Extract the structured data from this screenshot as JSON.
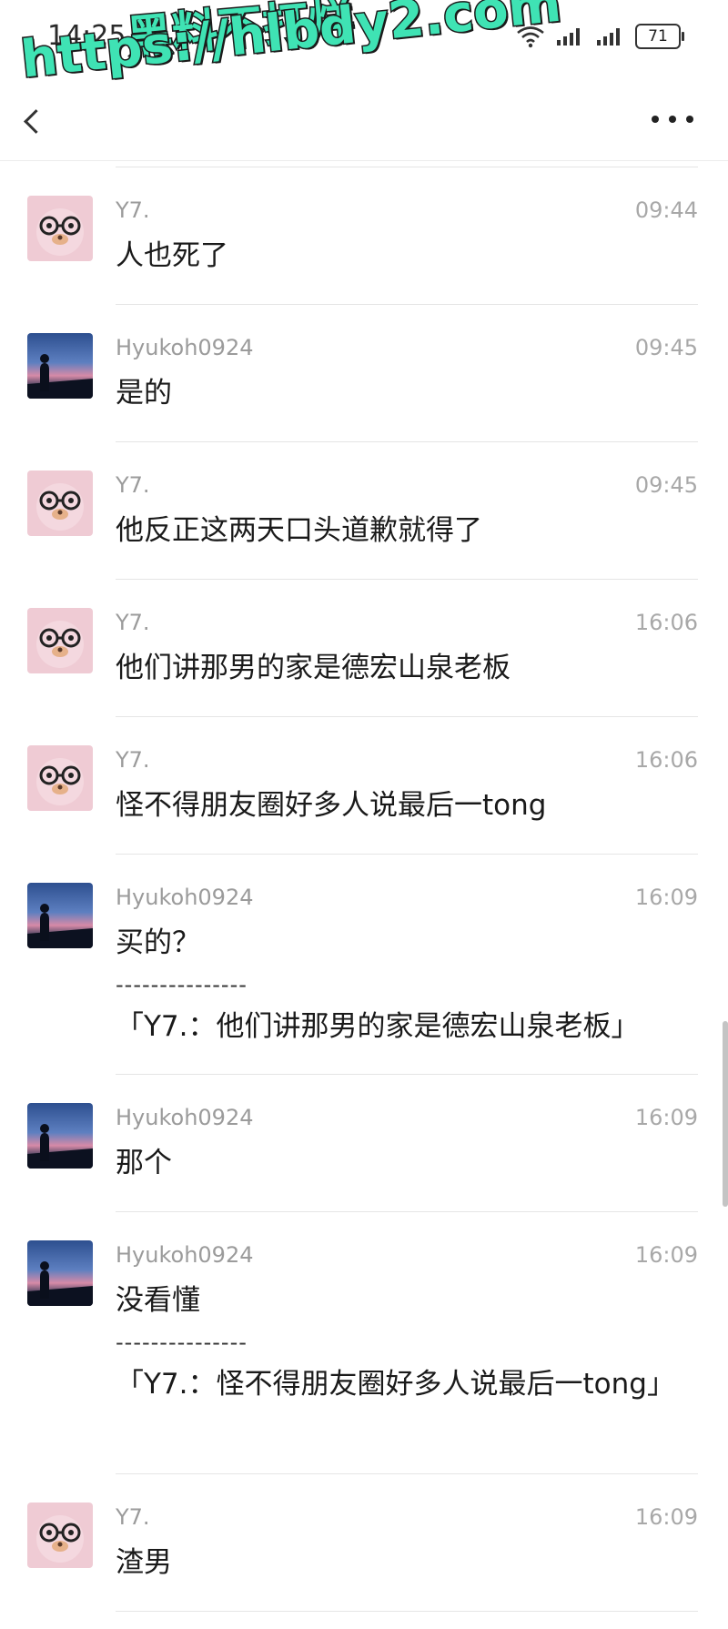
{
  "status": {
    "time": "14:25",
    "battery": "71"
  },
  "watermark": {
    "line1": "黑料不打烊",
    "line2": "https://hlbdy2.com"
  },
  "messages": [
    {
      "sender": "Y7.",
      "time": "09:44",
      "text": "人也死了",
      "avatar": "bear-avatar"
    },
    {
      "sender": "Hyukoh0924",
      "time": "09:45",
      "text": "是的",
      "avatar": "sunset-avatar"
    },
    {
      "sender": "Y7.",
      "time": "09:45",
      "text": "他反正这两天口头道歉就得了",
      "avatar": "bear-avatar"
    },
    {
      "sender": "Y7.",
      "time": "16:06",
      "text": "他们讲那男的家是德宏山泉老板",
      "avatar": "bear-avatar"
    },
    {
      "sender": "Y7.",
      "time": "16:06",
      "text": "怪不得朋友圈好多人说最后一tong",
      "avatar": "bear-avatar"
    },
    {
      "sender": "Hyukoh0924",
      "time": "16:09",
      "text": "买的？",
      "divider": "---------------",
      "quote": "「Y7.：他们讲那男的家是德宏山泉老板」",
      "avatar": "sunset-avatar"
    },
    {
      "sender": "Hyukoh0924",
      "time": "16:09",
      "text": "那个",
      "avatar": "sunset-avatar"
    },
    {
      "sender": "Hyukoh0924",
      "time": "16:09",
      "text": "没看懂",
      "divider": "---------------",
      "quote": "「Y7.：怪不得朋友圈好多人说最后一tong」",
      "avatar": "sunset-avatar"
    },
    {
      "sender": "Y7.",
      "time": "16:09",
      "text": "渣男",
      "avatar": "bear-avatar"
    }
  ]
}
